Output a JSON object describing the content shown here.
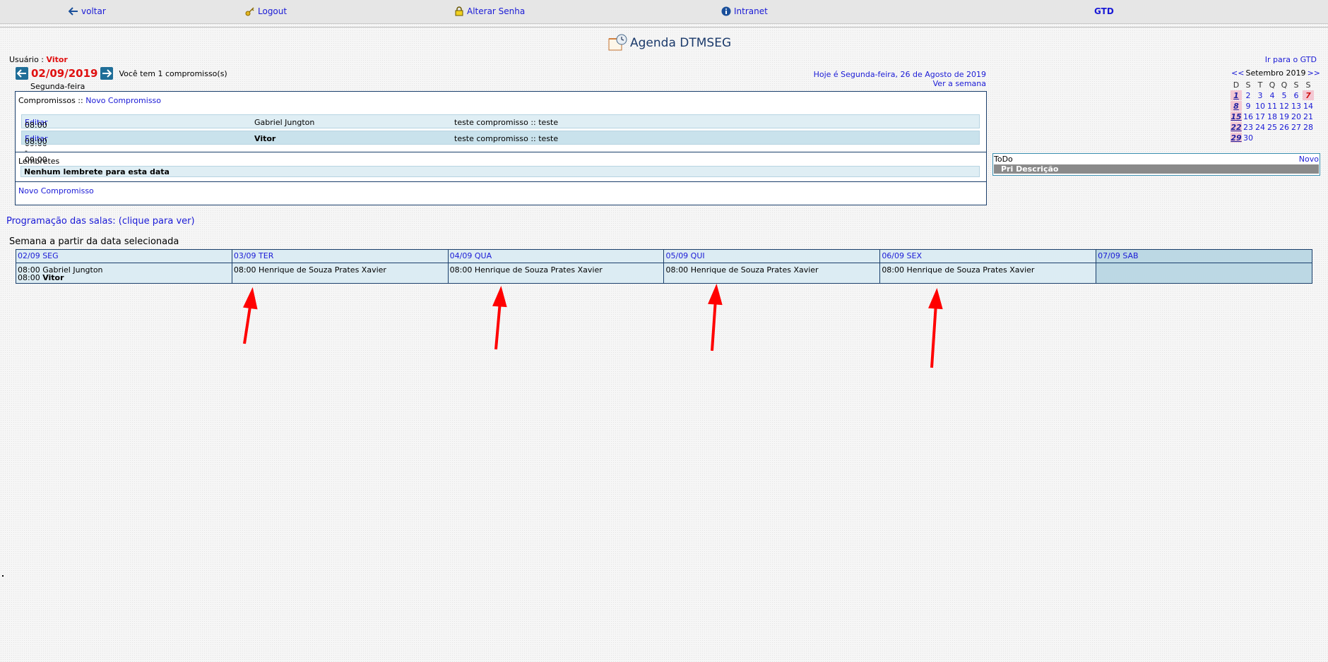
{
  "nav": {
    "voltar": "voltar",
    "logout": "Logout",
    "alterar_senha": "Alterar Senha",
    "intranet": "Intranet",
    "gtd": "GTD"
  },
  "page": {
    "title": "Agenda DTMSEG",
    "ir_para_gtd": "Ir para o GTD"
  },
  "user": {
    "label": "Usuário :",
    "name": "Vitor"
  },
  "date_nav": {
    "current_date": "02/09/2019",
    "count_text": "Você tem 1 compromisso(s)",
    "weekday": "Segunda-feira"
  },
  "today": {
    "text": "Hoje é Segunda-feira, 26 de Agosto de 2019",
    "ver_semana": "Ver a semana"
  },
  "compromissos": {
    "label": "Compromissos ::",
    "new_link": "Novo Compromisso",
    "rows": [
      {
        "time": "08:00 - 09:00",
        "edit": "Editar",
        "person": "Gabriel Jungton",
        "desc": "teste compromisso :: teste"
      },
      {
        "time": "08:00 - 09:00",
        "edit": "Editar",
        "person": "Vitor",
        "desc": "teste compromisso :: teste"
      }
    ]
  },
  "lembretes": {
    "label": "Lembretes",
    "empty": "Nenhum lembrete para esta data"
  },
  "bottom_new_link": "Novo Compromisso",
  "calendar": {
    "prev": "<<",
    "month": "Setembro 2019",
    "next": ">>",
    "dow": [
      "D",
      "S",
      "T",
      "Q",
      "Q",
      "S",
      "S"
    ],
    "weeks": [
      [
        "1",
        "2",
        "3",
        "4",
        "5",
        "6",
        "7"
      ],
      [
        "8",
        "9",
        "10",
        "11",
        "12",
        "13",
        "14"
      ],
      [
        "15",
        "16",
        "17",
        "18",
        "19",
        "20",
        "21"
      ],
      [
        "22",
        "23",
        "24",
        "25",
        "26",
        "27",
        "28"
      ],
      [
        "29",
        "30",
        "",
        "",
        "",
        "",
        ""
      ]
    ]
  },
  "todo": {
    "label": "ToDo",
    "new": "Novo",
    "header": "Pri Descrição"
  },
  "salas_link": "Programação das salas: (clique para ver)",
  "week_title": "Semana a partir da data selecionada",
  "week": [
    {
      "head": "02/09 SEG",
      "entries": [
        {
          "time": "08:00",
          "name": "Gabriel Jungton",
          "bold": false
        },
        {
          "time": "08:00",
          "name": "Vitor",
          "bold": true
        }
      ]
    },
    {
      "head": "03/09 TER",
      "entries": [
        {
          "time": "08:00",
          "name": "Henrique de Souza Prates Xavier",
          "bold": false
        }
      ]
    },
    {
      "head": "04/09 QUA",
      "entries": [
        {
          "time": "08:00",
          "name": "Henrique de Souza Prates Xavier",
          "bold": false
        }
      ]
    },
    {
      "head": "05/09 QUI",
      "entries": [
        {
          "time": "08:00",
          "name": "Henrique de Souza Prates Xavier",
          "bold": false
        }
      ]
    },
    {
      "head": "06/09 SEX",
      "entries": [
        {
          "time": "08:00",
          "name": "Henrique de Souza Prates Xavier",
          "bold": false
        }
      ]
    },
    {
      "head": "07/09 SAB",
      "entries": []
    }
  ],
  "colors": {
    "accent_red": "#e01010",
    "link_blue": "#1a1ad6",
    "border_navy": "#1a3e6b",
    "arrow_red": "#ff0000"
  }
}
